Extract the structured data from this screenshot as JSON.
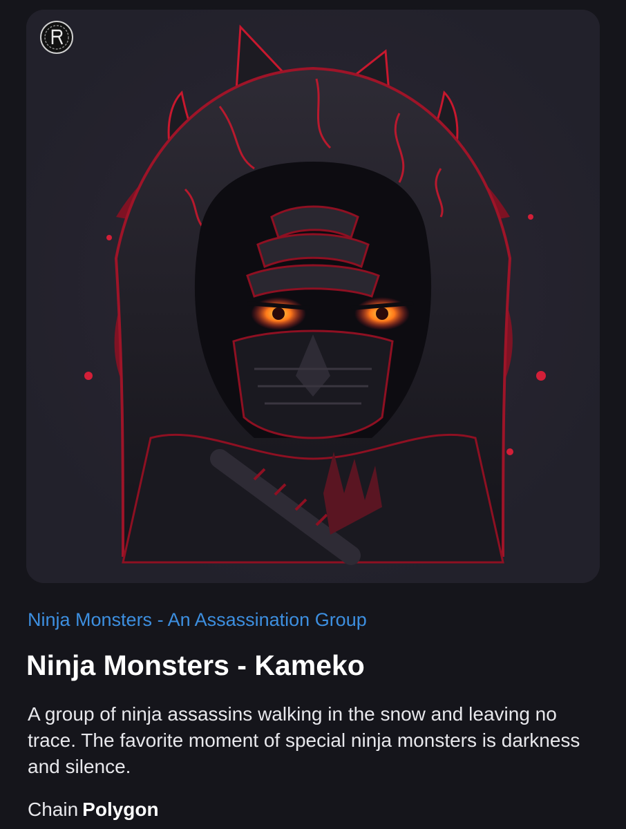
{
  "nft": {
    "collection_name": "Ninja Monsters - An Assassination Group",
    "title": "Ninja Monsters - Kameko",
    "description": "A group of ninja assassins walking in the snow and leaving no trace. The favorite moment of special ninja monsters is darkness and silence.",
    "chain_label": "Chain",
    "chain_value": "Polygon",
    "artwork_icon": "ninja-monster-artwork",
    "badge_icon": "creator-emblem-icon"
  },
  "colors": {
    "background": "#15151b",
    "card": "#22212b",
    "link": "#3d8fe0",
    "accent_red": "#c8182e",
    "eye_orange": "#ff7a1a"
  }
}
